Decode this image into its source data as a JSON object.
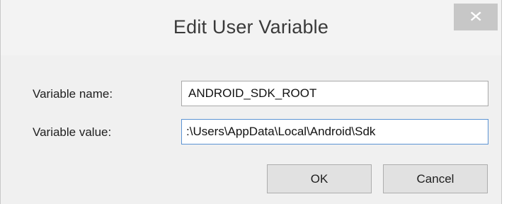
{
  "window": {
    "title": "Edit User Variable",
    "close_glyph": "✕"
  },
  "form": {
    "name_label": "Variable name:",
    "name_value": "ANDROID_SDK_ROOT",
    "value_label": "Variable value:",
    "value_value": ":\\Users\\AppData\\Local\\Android\\Sdk"
  },
  "buttons": {
    "ok_label": "OK",
    "cancel_label": "Cancel"
  },
  "colors": {
    "dialog_background": "#f0f0f0",
    "close_button": "#c7c7c7",
    "focused_field_border": "#5b93d3"
  }
}
